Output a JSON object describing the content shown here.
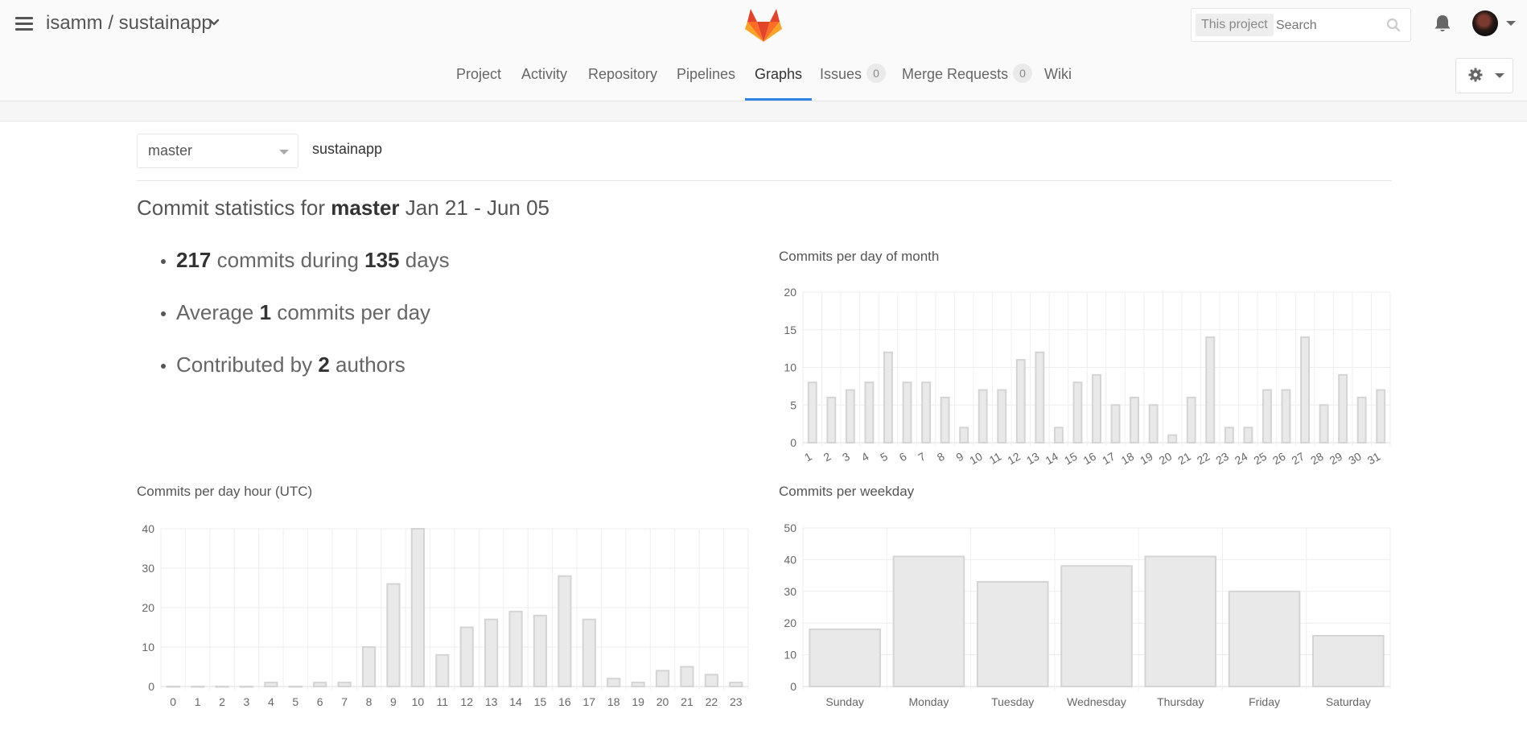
{
  "header": {
    "project": "isamm / sustainapp",
    "search_scope": "This project",
    "search_placeholder": "Search",
    "icons": [
      "hamburger-icon",
      "chevron-down-icon",
      "gitlab-logo",
      "search-icon",
      "bell-icon",
      "avatar",
      "gear-icon",
      "caret-down-icon"
    ]
  },
  "nav": {
    "tabs": [
      {
        "label": "Project"
      },
      {
        "label": "Activity"
      },
      {
        "label": "Repository"
      },
      {
        "label": "Pipelines"
      },
      {
        "label": "Graphs",
        "active": true
      },
      {
        "label": "Issues",
        "count": "0"
      },
      {
        "label": "Merge Requests",
        "count": "0"
      },
      {
        "label": "Wiki"
      }
    ]
  },
  "branch": {
    "selected": "master",
    "repo": "sustainapp"
  },
  "stats": {
    "heading_prefix": "Commit statistics for",
    "branch": "master",
    "range": "Jan 21 - Jun 05",
    "commits": "217",
    "commits_text": "commits during",
    "days": "135",
    "days_text": "days",
    "average_prefix": "Average",
    "average": "1",
    "average_suffix": "commits per day",
    "authors_prefix": "Contributed by",
    "authors": "2",
    "authors_suffix": "authors"
  },
  "chart_data": [
    {
      "title": "Commits per day of month",
      "type": "bar",
      "categories": [
        "1",
        "2",
        "3",
        "4",
        "5",
        "6",
        "7",
        "8",
        "9",
        "10",
        "11",
        "12",
        "13",
        "14",
        "15",
        "16",
        "17",
        "18",
        "19",
        "20",
        "21",
        "22",
        "23",
        "24",
        "25",
        "26",
        "27",
        "28",
        "29",
        "30",
        "31"
      ],
      "values": [
        8,
        6,
        7,
        8,
        12,
        8,
        8,
        6,
        2,
        7,
        7,
        11,
        12,
        2,
        8,
        9,
        5,
        6,
        5,
        1,
        6,
        14,
        2,
        2,
        7,
        7,
        14,
        5,
        9,
        6,
        7
      ],
      "ylim": [
        0,
        20
      ],
      "yticks": [
        0,
        5,
        10,
        15,
        20
      ],
      "grid": true
    },
    {
      "title": "Commits per day hour (UTC)",
      "type": "bar",
      "categories": [
        "0",
        "1",
        "2",
        "3",
        "4",
        "5",
        "6",
        "7",
        "8",
        "9",
        "10",
        "11",
        "12",
        "13",
        "14",
        "15",
        "16",
        "17",
        "18",
        "19",
        "20",
        "21",
        "22",
        "23"
      ],
      "values": [
        0,
        0,
        0,
        0,
        1,
        0,
        1,
        1,
        10,
        26,
        40,
        8,
        15,
        17,
        19,
        18,
        28,
        17,
        2,
        1,
        4,
        5,
        3,
        1
      ],
      "ylim": [
        0,
        40
      ],
      "yticks": [
        0,
        10,
        20,
        30,
        40
      ],
      "grid": true
    },
    {
      "title": "Commits per weekday",
      "type": "bar",
      "categories": [
        "Sunday",
        "Monday",
        "Tuesday",
        "Wednesday",
        "Thursday",
        "Friday",
        "Saturday"
      ],
      "values": [
        18,
        41,
        33,
        38,
        41,
        30,
        16
      ],
      "ylim": [
        0,
        50
      ],
      "yticks": [
        0,
        10,
        20,
        30,
        40,
        50
      ],
      "grid": true
    }
  ]
}
